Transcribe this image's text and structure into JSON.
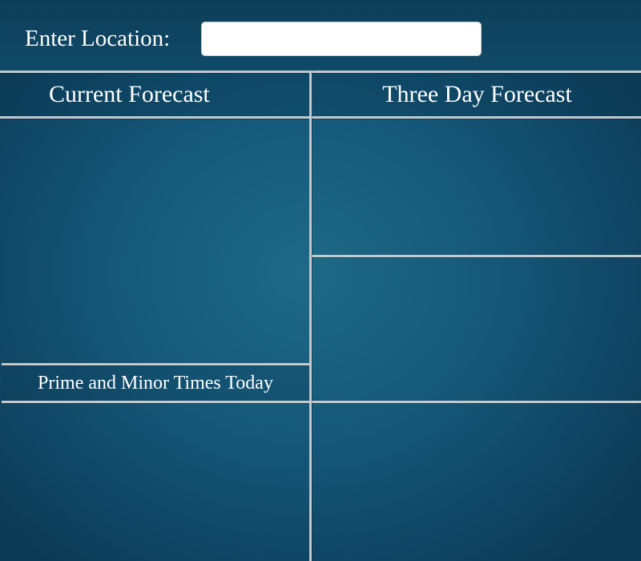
{
  "location": {
    "label": "Enter Location:",
    "value": "",
    "placeholder": ""
  },
  "headers": {
    "current": "Current Forecast",
    "three_day": "Three Day Forecast",
    "prime_minor": "Prime and Minor Times Today"
  },
  "colors": {
    "background": "#15587a",
    "divider": "#c4c9cc",
    "text": "#ffffff"
  }
}
